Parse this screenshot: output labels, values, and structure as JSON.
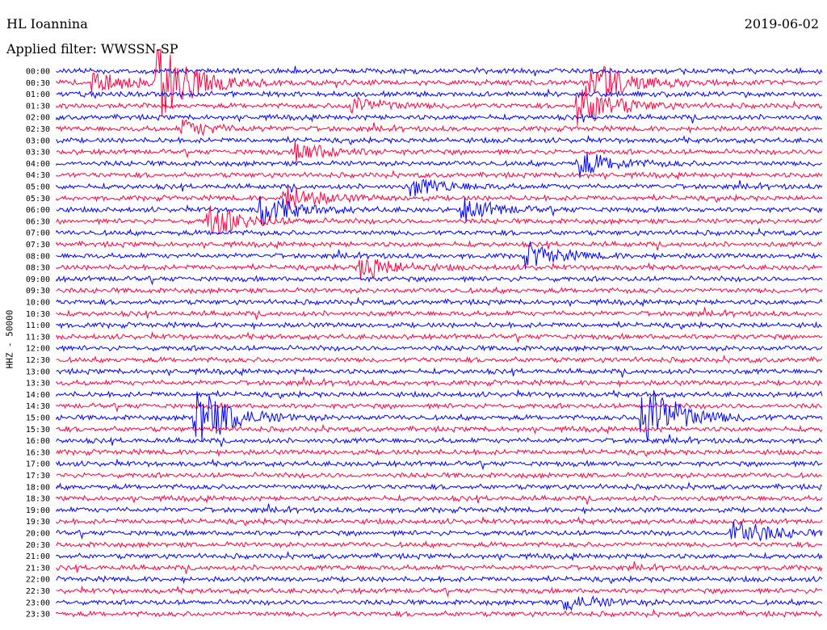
{
  "header": {
    "station": "HL Ioannina",
    "filter": "Applied filter: WWSSN-SP",
    "date": "2019-06-02",
    "channel": "HHZ - 50000"
  },
  "chart_data": {
    "type": "helicorder",
    "title": "HL Ioannina",
    "date": "2019-06-02",
    "filter": "WWSSN-SP",
    "ylabel": "HHZ - 50000",
    "xlabel": "",
    "row_interval_minutes": 30,
    "trace_colors": [
      "#0000ff",
      "#ff0040"
    ],
    "grid": false,
    "rows": [
      "00:00",
      "00:30",
      "01:00",
      "01:30",
      "02:00",
      "02:30",
      "03:00",
      "03:30",
      "04:00",
      "04:30",
      "05:00",
      "05:30",
      "06:00",
      "06:30",
      "07:00",
      "07:30",
      "08:00",
      "08:30",
      "09:00",
      "09:30",
      "10:00",
      "10:30",
      "11:00",
      "11:30",
      "12:00",
      "12:30",
      "13:00",
      "13:30",
      "14:00",
      "14:30",
      "15:00",
      "15:30",
      "16:00",
      "16:30",
      "17:00",
      "17:30",
      "18:00",
      "18:30",
      "19:00",
      "19:30",
      "20:00",
      "20:30",
      "21:00",
      "21:30",
      "22:00",
      "22:30",
      "23:00",
      "23:30"
    ],
    "events": [
      {
        "row": "00:30",
        "minute": 1.5,
        "amplitude": 1.6
      },
      {
        "row": "00:30",
        "minute": 4,
        "amplitude": 6.0
      },
      {
        "row": "00:30",
        "minute": 21.5,
        "amplitude": 1.2
      },
      {
        "row": "00:30",
        "minute": 21.0,
        "amplitude": 1.8
      },
      {
        "row": "01:30",
        "minute": 11.5,
        "amplitude": 1.5
      },
      {
        "row": "01:30",
        "minute": 20.5,
        "amplitude": 3.5
      },
      {
        "row": "02:30",
        "minute": 5,
        "amplitude": 1.2
      },
      {
        "row": "03:30",
        "minute": 9.5,
        "amplitude": 1.5
      },
      {
        "row": "04:00",
        "minute": 20.5,
        "amplitude": 2.0
      },
      {
        "row": "05:00",
        "minute": 14,
        "amplitude": 1.4
      },
      {
        "row": "05:30",
        "minute": 9,
        "amplitude": 2.0
      },
      {
        "row": "06:00",
        "minute": 8,
        "amplitude": 2.5
      },
      {
        "row": "06:00",
        "minute": 16,
        "amplitude": 1.6
      },
      {
        "row": "06:30",
        "minute": 6,
        "amplitude": 2.5
      },
      {
        "row": "08:00",
        "minute": 18.5,
        "amplitude": 1.8
      },
      {
        "row": "08:30",
        "minute": 12,
        "amplitude": 1.8
      },
      {
        "row": "15:00",
        "minute": 5.5,
        "amplitude": 5.0
      },
      {
        "row": "15:00",
        "minute": 23,
        "amplitude": 6.0
      },
      {
        "row": "20:00",
        "minute": 26.5,
        "amplitude": 2.5
      },
      {
        "row": "23:00",
        "minute": 20,
        "amplitude": 1.2
      }
    ]
  }
}
